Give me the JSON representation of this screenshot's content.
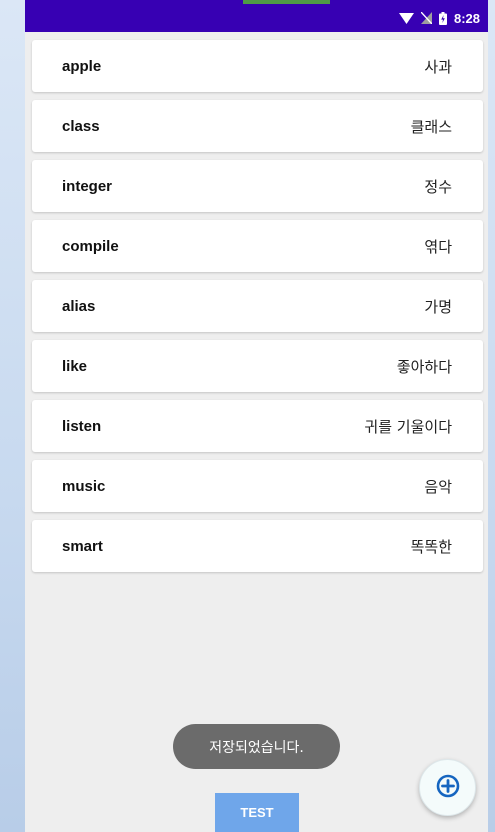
{
  "status": {
    "time": "8:28"
  },
  "words": [
    {
      "en": "apple",
      "ko": "사과"
    },
    {
      "en": "class",
      "ko": "클래스"
    },
    {
      "en": "integer",
      "ko": "정수"
    },
    {
      "en": "compile",
      "ko": "엮다"
    },
    {
      "en": "alias",
      "ko": "가명"
    },
    {
      "en": "like",
      "ko": "좋아하다"
    },
    {
      "en": "listen",
      "ko": "귀를 기울이다"
    },
    {
      "en": "music",
      "ko": "음악"
    },
    {
      "en": "smart",
      "ko": "똑똑한"
    }
  ],
  "toast": {
    "message": "저장되었습니다."
  },
  "buttons": {
    "test_label": "TEST",
    "fab_icon": "add-circle-icon"
  },
  "colors": {
    "status_bar": "#3700b3",
    "fab_accent": "#1565c0",
    "test_button": "#6fa6ea"
  }
}
